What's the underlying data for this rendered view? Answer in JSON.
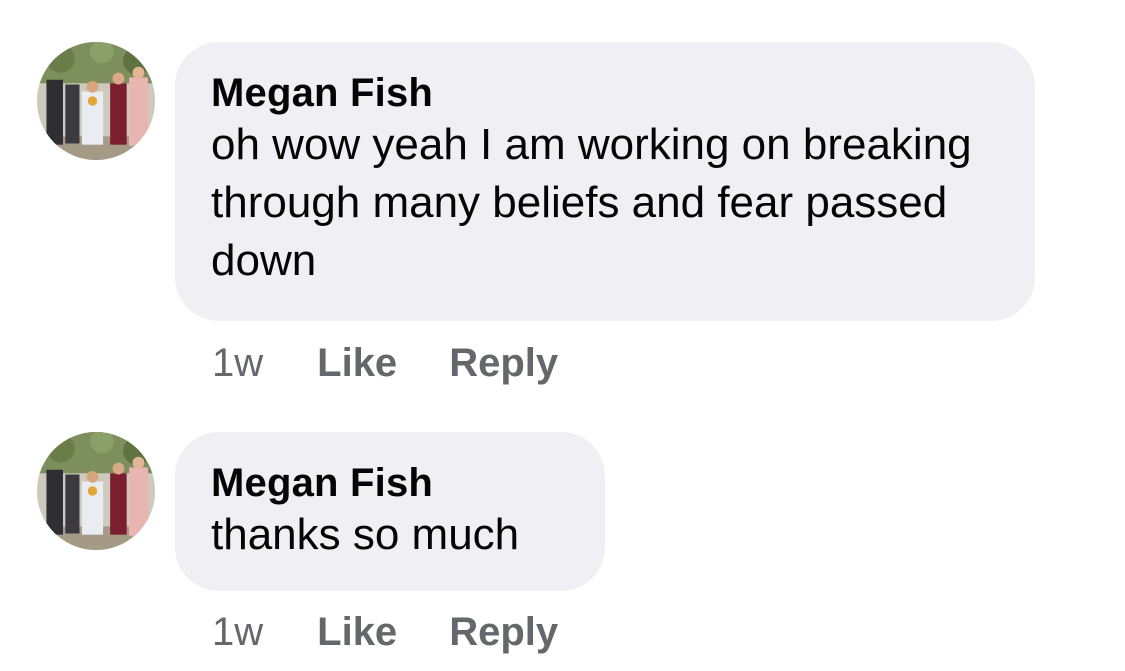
{
  "comments": [
    {
      "author": "Megan Fish",
      "text": "oh wow yeah I am working on breaking through many beliefs and fear passed down",
      "time": "1w",
      "like_label": "Like",
      "reply_label": "Reply"
    },
    {
      "author": "Megan Fish",
      "text": "thanks so much",
      "time": "1w",
      "like_label": "Like",
      "reply_label": "Reply"
    }
  ],
  "colors": {
    "bubble": "#f0f0f4",
    "meta_text": "#65676b",
    "primary_text": "#050505"
  }
}
